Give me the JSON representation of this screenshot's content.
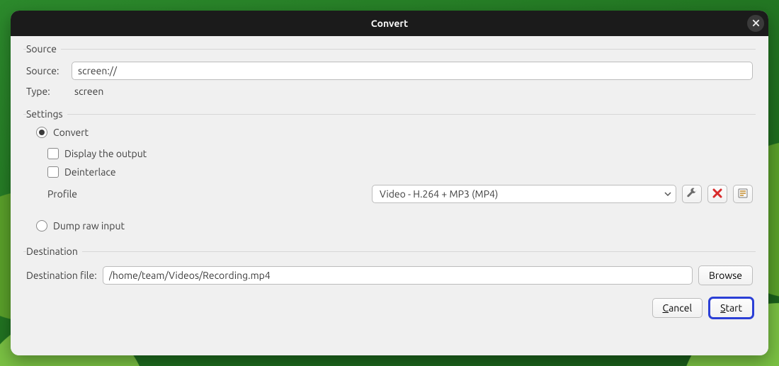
{
  "window": {
    "title": "Convert"
  },
  "source": {
    "legend": "Source",
    "source_label": "Source:",
    "source_value": "screen://",
    "type_label": "Type:",
    "type_value": "screen"
  },
  "settings": {
    "legend": "Settings",
    "convert_label": "Convert",
    "display_output_label": "Display the output",
    "deinterlace_label": "Deinterlace",
    "profile_label": "Profile",
    "profile_value": "Video - H.264 + MP3 (MP4)",
    "dump_raw_label": "Dump raw input"
  },
  "destination": {
    "legend": "Destination",
    "file_label": "Destination file:",
    "file_value": "/home/team/Videos/Recording.mp4",
    "browse_label": "Browse"
  },
  "footer": {
    "cancel_prefix": "C",
    "cancel_rest": "ancel",
    "start_prefix": "S",
    "start_rest": "tart"
  },
  "icons": {
    "close": "close-icon",
    "caret_down": "chevron-down-icon",
    "wrench": "wrench-icon",
    "delete_x": "x-red-icon",
    "new_profile": "new-profile-icon"
  }
}
